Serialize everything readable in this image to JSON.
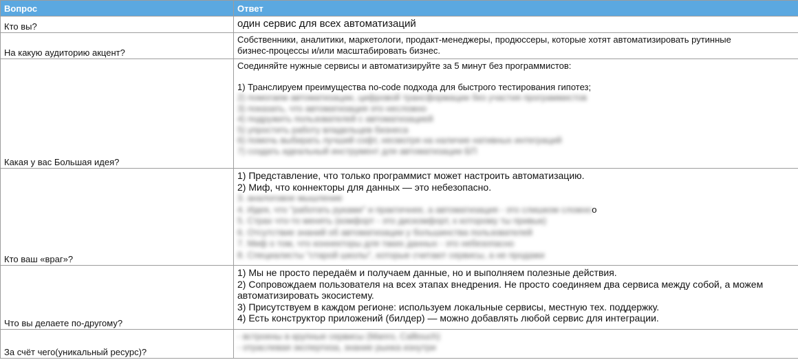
{
  "header": {
    "question": "Вопрос",
    "answer": "Ответ"
  },
  "rows": [
    {
      "question": "Кто вы?",
      "answer_lines": [
        "один сервис для всех автоматизаций"
      ]
    },
    {
      "question": "На какую аудиторию акцент?",
      "answer_lines": [
        "Собственники, аналитики, маркетологи, продакт-менеджеры, продюссеры, которые хотят автоматизировать рутинные",
        "бизнес-процессы и/или масштабировать бизнес."
      ]
    },
    {
      "question": "Какая у вас Большая идея?",
      "answer_lines": [
        "Соединяйте нужные сервисы и автоматизируйте за 5 минут без программистов:",
        "1) Транслируем преимущества no-code подхода для быстрого тестирования гипотез;"
      ],
      "blurred_lines": [
        "2) помогаем автоматизации, цифровой трансформации без участия программистов",
        "3) показать, что автоматизация это несложно",
        "4) подружить пользователей с автоматизацией",
        "5) упростить работу владельцев бизнеса",
        "6) помочь выбирать лучший софт, несмотря на наличие нативных интеграций",
        "7) создать идеальный инструмент для автоматизации БП"
      ]
    },
    {
      "question": "Кто ваш «враг»?",
      "answer_lines": [
        "1) Представление, что только программист может настроить автоматизацию.",
        "2) Миф, что коннекторы для данных — это небезопасно."
      ],
      "blurred_lines": [
        "3. аналоговое мышление",
        "4. Идея, что \"работать руками\" и практичнее, а автоматизация - это слишком сложно",
        "5. Страх что-то менять (комфорт - это дискомфорт, к которому ты привык)",
        "6. Отсутствие знаний об автоматизации у большинства пользователей",
        "7. Миф о том, что коннекторы для таких данных - это небезопасно",
        "8. Специалисты \"старой школы\", которые считают сервисы, а не продажи"
      ],
      "stray_char": "o"
    },
    {
      "question": "Что вы делаете по-другому?",
      "answer_lines": [
        "1) Мы не просто передаём и получаем данные, но и выполняем полезные действия.",
        "2) Сопровождаем пользователя на всех этапах внедрения. Не просто соединяем два сервиса между собой, а можем",
        "автоматизировать экосистему.",
        "3) Присутствуем в каждом регионе: используем локальные сервисы, местную тех. поддержку.",
        "4) Есть конструктор приложений (билдер) — можно добавлять любой сервис для интеграции."
      ]
    },
    {
      "question": "За счёт чего(уникальный ресурс)?",
      "blurred_lines": [
        "- встроены в крупные сервисы (Manго, Calltouch)",
        "- отраслевая экспертиза, знание рынка изнутри"
      ]
    }
  ],
  "colors": {
    "header_bg": "#5ba8e0",
    "header_text": "#ffffff",
    "border": "#9c9c9c"
  }
}
